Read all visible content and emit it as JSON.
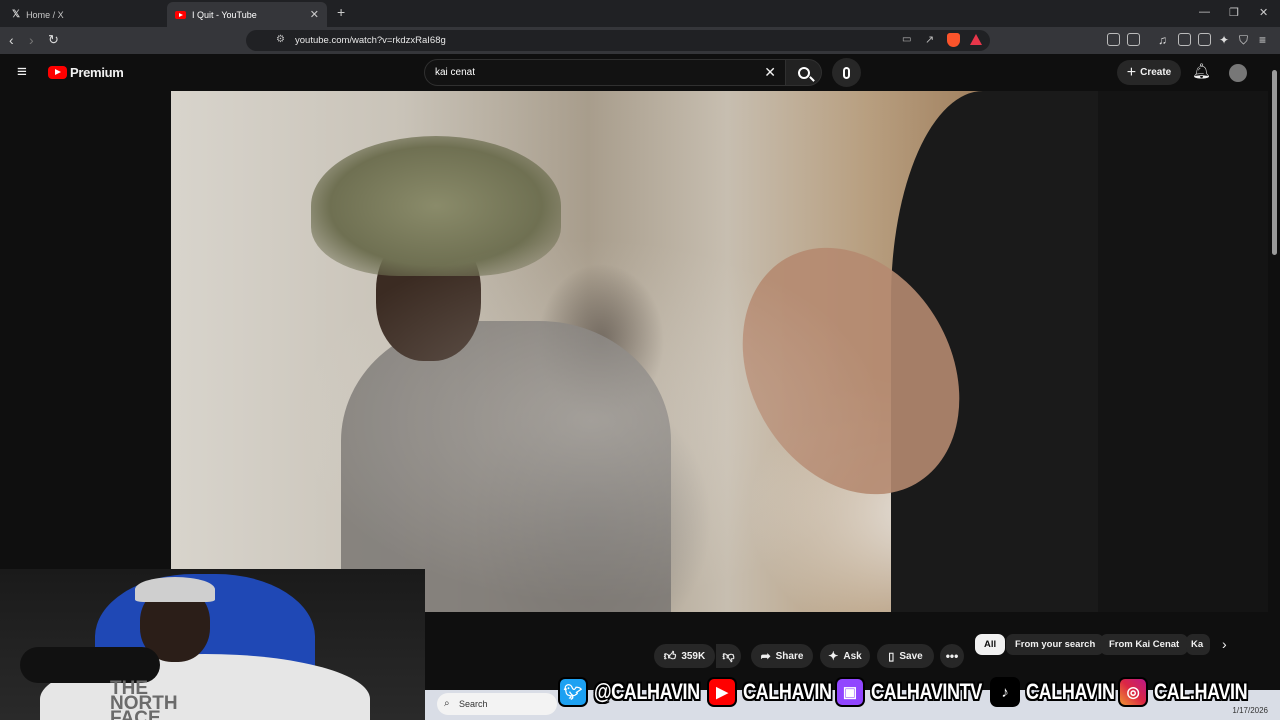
{
  "browser": {
    "tabs": [
      {
        "title": "Home / X",
        "icon": "x-logo-icon"
      },
      {
        "title": "I Quit - YouTube",
        "icon": "youtube-icon"
      }
    ],
    "new_tab": "+",
    "url": "youtube.com/watch?v=rkdzxRaI68g"
  },
  "youtube": {
    "logo_text": "Premium",
    "search_value": "kai cenat",
    "create_label": "Create"
  },
  "actions": {
    "like_count": "359K",
    "share_label": "Share",
    "ask_label": "Ask",
    "save_label": "Save"
  },
  "chips": [
    "All",
    "From your search",
    "From Kai Cenat",
    "Ka"
  ],
  "webcam": {
    "shirt_logo": "THE NORTH FACE"
  },
  "taskbar": {
    "search_label": "Search",
    "date": "1/17/2026"
  },
  "socials": [
    {
      "icon": "twitter-icon",
      "color": "#1da1f2",
      "handle": "@CALHAVIN"
    },
    {
      "icon": "youtube-icon",
      "color": "#ff0000",
      "handle": "CALHAVIN"
    },
    {
      "icon": "twitch-icon",
      "color": "#9146ff",
      "handle": "CALHAVINTV"
    },
    {
      "icon": "tiktok-icon",
      "color": "#000000",
      "handle": "CALHAVIN"
    },
    {
      "icon": "instagram-icon",
      "color": "#d6249f",
      "handle": "CAL.HAVIN"
    }
  ],
  "colors": {
    "youtube_red": "#ff0000",
    "bg": "#0f0f0f"
  }
}
